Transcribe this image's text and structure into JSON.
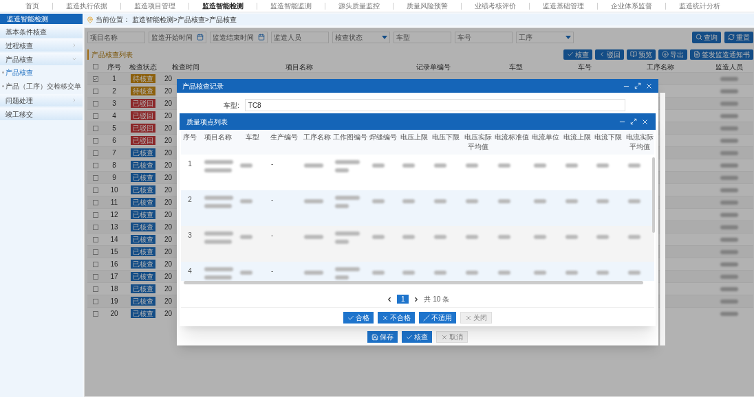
{
  "nav": [
    {
      "label": "首页",
      "selected": false
    },
    {
      "label": "监造执行依据",
      "selected": false
    },
    {
      "label": "监造项目管理",
      "selected": false
    },
    {
      "label": "监造智能检测",
      "selected": true
    },
    {
      "label": "监造智能监测",
      "selected": false
    },
    {
      "label": "源头质量监控",
      "selected": false
    },
    {
      "label": "质量风险预警",
      "selected": false
    },
    {
      "label": "业绩考核评价",
      "selected": false
    },
    {
      "label": "监造基础管理",
      "selected": false
    },
    {
      "label": "企业体系监督",
      "selected": false
    },
    {
      "label": "监造统计分析",
      "selected": false
    }
  ],
  "sidebar": {
    "title": "监造智能检测",
    "items": [
      {
        "label": "基本条件核查",
        "kind": "link"
      },
      {
        "label": "过程核查",
        "kind": "group",
        "expanded": false
      },
      {
        "label": "产品核查",
        "kind": "group",
        "expanded": true,
        "children": [
          {
            "label": "产品核查",
            "selected": true
          },
          {
            "label": "产品（工序）交检移交单",
            "selected": false
          }
        ]
      },
      {
        "label": "问题处理",
        "kind": "group",
        "expanded": false
      },
      {
        "label": "竣工移交",
        "kind": "link"
      }
    ]
  },
  "breadcrumb": {
    "label": "当前位置：",
    "path": "监造智能检测>产品核查>产品核查"
  },
  "filters": [
    {
      "placeholder": "项目名称",
      "kind": "text"
    },
    {
      "placeholder": "监造开始时间",
      "kind": "date"
    },
    {
      "placeholder": "监造结束时间",
      "kind": "date"
    },
    {
      "placeholder": "监造人员",
      "kind": "text"
    },
    {
      "placeholder": "核查状态",
      "kind": "select"
    },
    {
      "placeholder": "车型",
      "kind": "text"
    },
    {
      "placeholder": "车号",
      "kind": "text"
    },
    {
      "placeholder": "工序",
      "kind": "select"
    }
  ],
  "search_buttons": [
    "查询",
    "重置"
  ],
  "list": {
    "title": "产品核查列表",
    "toolbar": [
      "核查",
      "驳回",
      "预览",
      "导出",
      "签发监造通知书"
    ],
    "header_checked": false,
    "columns": [
      "序号",
      "检查状态",
      "检查时间",
      "项目名称",
      "记录单编号",
      "车型",
      "车号",
      "工序名称",
      "监造人员"
    ],
    "rows": [
      {
        "index": "1",
        "checked": true,
        "status": {
          "label": "待核查",
          "kind": "pending"
        },
        "time": "20"
      },
      {
        "index": "2",
        "checked": false,
        "status": {
          "label": "待核查",
          "kind": "pending"
        },
        "time": "20"
      },
      {
        "index": "3",
        "checked": false,
        "status": {
          "label": "已驳回",
          "kind": "rejected"
        },
        "time": "20"
      },
      {
        "index": "4",
        "checked": false,
        "status": {
          "label": "已驳回",
          "kind": "rejected"
        },
        "time": "20"
      },
      {
        "index": "5",
        "checked": false,
        "status": {
          "label": "已驳回",
          "kind": "rejected"
        },
        "time": "20"
      },
      {
        "index": "6",
        "checked": false,
        "status": {
          "label": "已驳回",
          "kind": "rejected"
        },
        "time": "20"
      },
      {
        "index": "7",
        "checked": false,
        "status": {
          "label": "已核查",
          "kind": "done"
        },
        "time": "20"
      },
      {
        "index": "8",
        "checked": false,
        "status": {
          "label": "已核查",
          "kind": "done"
        },
        "time": "20"
      },
      {
        "index": "9",
        "checked": false,
        "status": {
          "label": "已核查",
          "kind": "done"
        },
        "time": "20"
      },
      {
        "index": "10",
        "checked": false,
        "status": {
          "label": "已核查",
          "kind": "done"
        },
        "time": "20"
      },
      {
        "index": "11",
        "checked": false,
        "status": {
          "label": "已核查",
          "kind": "done"
        },
        "time": "20"
      },
      {
        "index": "12",
        "checked": false,
        "status": {
          "label": "已核查",
          "kind": "done"
        },
        "time": "20"
      },
      {
        "index": "13",
        "checked": false,
        "status": {
          "label": "已核查",
          "kind": "done"
        },
        "time": "20"
      },
      {
        "index": "14",
        "checked": false,
        "status": {
          "label": "已核查",
          "kind": "done"
        },
        "time": "20"
      },
      {
        "index": "15",
        "checked": false,
        "status": {
          "label": "已核查",
          "kind": "done"
        },
        "time": "20"
      },
      {
        "index": "16",
        "checked": false,
        "status": {
          "label": "已核查",
          "kind": "done"
        },
        "time": "20"
      },
      {
        "index": "17",
        "checked": false,
        "status": {
          "label": "已核查",
          "kind": "done"
        },
        "time": "20"
      },
      {
        "index": "18",
        "checked": false,
        "status": {
          "label": "已核查",
          "kind": "done"
        },
        "time": "20"
      },
      {
        "index": "19",
        "checked": false,
        "status": {
          "label": "已核查",
          "kind": "done"
        },
        "time": "20"
      },
      {
        "index": "20",
        "checked": false,
        "status": {
          "label": "已核查",
          "kind": "done"
        },
        "time": "20"
      }
    ]
  },
  "record_dialog": {
    "title": "产品核查记录",
    "field": {
      "label": "车型:",
      "value": "TC8"
    },
    "buttons": [
      {
        "label": "保存",
        "disabled": false
      },
      {
        "label": "核查",
        "disabled": false
      },
      {
        "label": "取消",
        "disabled": true
      }
    ]
  },
  "items_dialog": {
    "title": "质量项点列表",
    "columns": [
      "序号",
      "项目名称",
      "车型",
      "生产编号",
      "工序名称",
      "工作图编号",
      "焊缝编号",
      "电压上限",
      "电压下限",
      "电压实际平均值",
      "电流标准值",
      "电流单位",
      "电流上限",
      "电流下限",
      "电流实际平均值"
    ],
    "rows": [
      {
        "index": "1",
        "production_no": "-"
      },
      {
        "index": "2",
        "production_no": "-"
      },
      {
        "index": "3",
        "production_no": "-"
      },
      {
        "index": "4",
        "production_no": "-"
      }
    ],
    "pagination": {
      "page": "1",
      "total": "共 10 条"
    },
    "buttons": [
      {
        "label": "合格",
        "disabled": false
      },
      {
        "label": "不合格",
        "disabled": false
      },
      {
        "label": "不适用",
        "disabled": false
      },
      {
        "label": "关闭",
        "disabled": true
      }
    ]
  }
}
